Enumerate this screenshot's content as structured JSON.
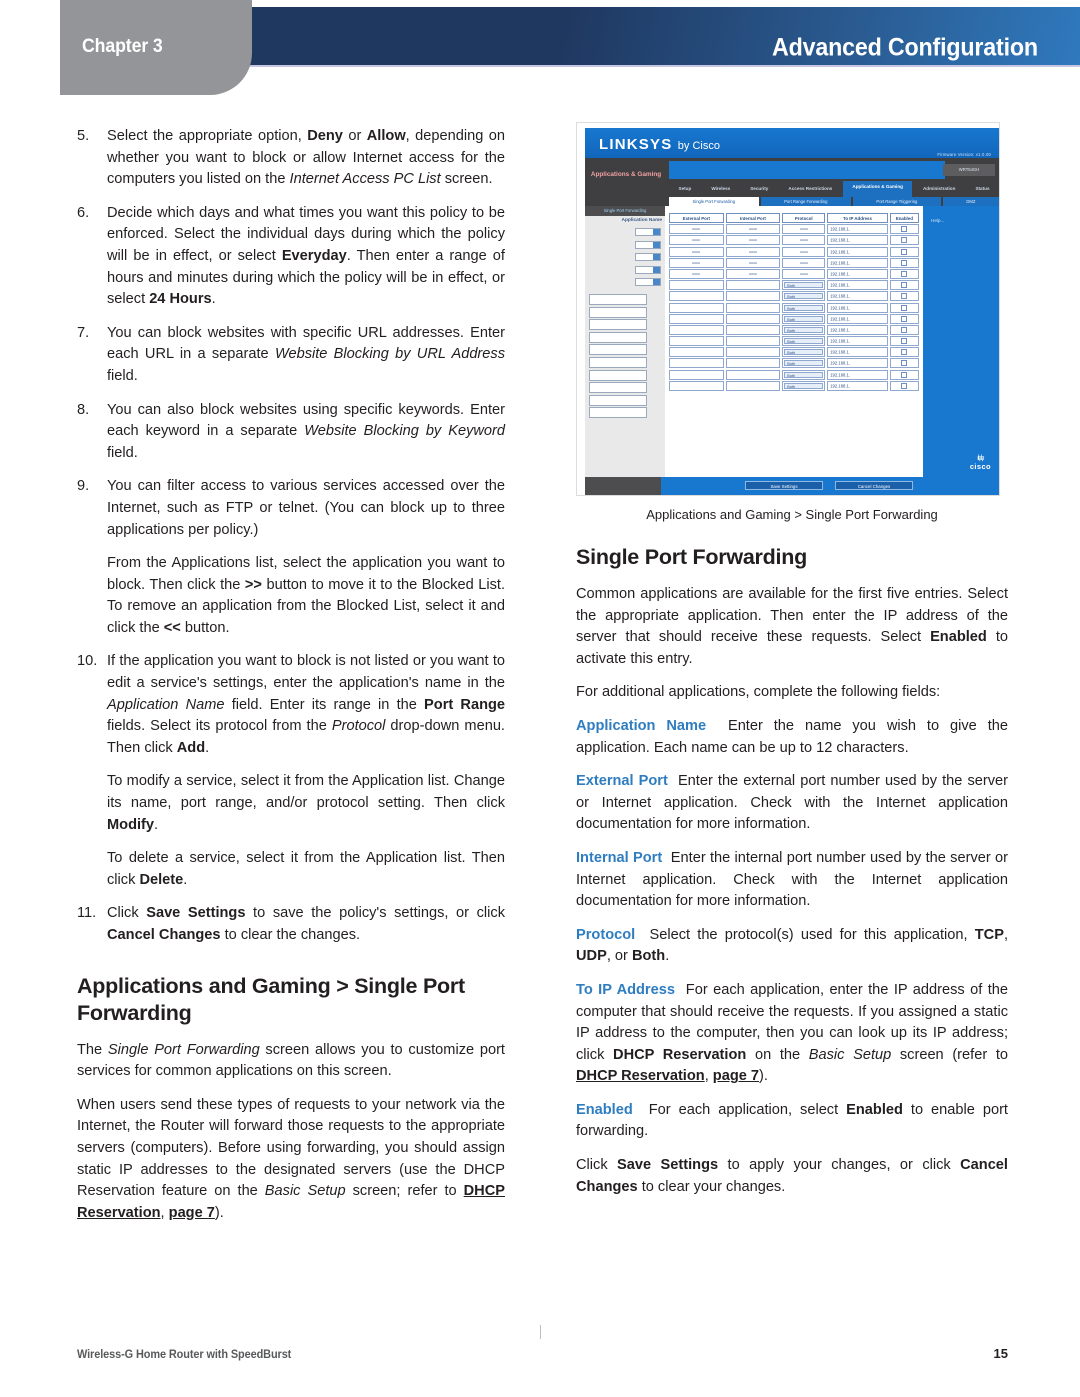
{
  "header": {
    "chapter_label": "Chapter 3",
    "title": "Advanced Configuration",
    "accent_dark": "#1f3860",
    "accent_light": "#2f79bd",
    "tab_gray": "#939598"
  },
  "left_column": {
    "steps": [
      {
        "number": "5.",
        "html": "Select the appropriate option, <b>Deny</b> or <b>Allow</b>, depending on whether you want to block or allow Internet access for the computers you listed on the <i>Internet Access PC List</i> screen."
      },
      {
        "number": "6.",
        "html": "Decide which days and what times you want this policy to be enforced. Select the individual days during which the policy will be in effect, or select <b>Everyday</b>. Then enter a range of hours and minutes during which the policy will be in effect, or select <b>24&nbsp;Hours</b>."
      },
      {
        "number": "7.",
        "html": "You can block websites with specific URL addresses. Enter each URL in a separate <i>Website Blocking by URL Address</i> field."
      },
      {
        "number": "8.",
        "html": "You can also block websites using specific keywords. Enter each keyword in a separate <i>Website Blocking by Keyword</i> field."
      },
      {
        "number": "9.",
        "html": "You can filter access to various services accessed over the Internet, such as FTP or telnet. (You can block up to three applications per policy.)",
        "extra": [
          "From the Applications list, select the application you want to block. Then click the <b>&gt;&gt;</b> button to move it to the Blocked List. To remove an application from the Blocked List, select it and click the <b>&lt;&lt;</b> button."
        ]
      },
      {
        "number": "10.",
        "html": "If the application you want to block is not listed or you want to edit a service's settings, enter the application's name in the <i>Application Name</i> field. Enter its range in the <b>Port Range</b> fields. Select its protocol from the <i>Protocol</i> drop-down menu. Then click <b>Add</b>.",
        "extra": [
          "To modify a service, select it from the Application list. Change its name, port range, and/or protocol setting. Then click <b>Modify</b>.",
          "To delete a service, select it from the Application list. Then click <b>Delete</b>."
        ]
      },
      {
        "number": "11.",
        "html": "Click <b>Save Settings</b> to save the policy's settings, or click <b>Cancel Changes</b> to clear the changes."
      }
    ],
    "section_heading": "Applications and Gaming > Single Port Forwarding",
    "paragraphs": [
      "The <i>Single Port Forwarding</i> screen allows you to customize port services for common applications on this screen.",
      "When users send these types of requests to your network via the Internet, the Router will forward those requests to the appropriate servers (computers). Before using forwarding, you should assign static IP addresses to the designated servers (use the DHCP Reservation feature on the <i>Basic Setup</i> screen; refer to <b class=\"ul-bold\">DHCP Reservation</b>, <b class=\"ul-bold\">page 7</b>)."
    ]
  },
  "screenshot": {
    "logo": "LINKSYS",
    "logo_suffix": "by Cisco",
    "firmware": "Firmware Version: v1.0.00",
    "model_button": "WRT54GH",
    "section_title": "Applications & Gaming",
    "tabs": [
      "Setup",
      "Wireless",
      "Security",
      "Access Restrictions",
      "Applications & Gaming",
      "Administration",
      "Status"
    ],
    "active_tab": "Applications & Gaming",
    "subtabs": [
      "Single Port Forwarding",
      "Port Range Forwarding",
      "Port Range Triggering",
      "DMZ"
    ],
    "active_subtab": "Single Port Forwarding",
    "sidebar_header": "Single Port Forwarding",
    "sidebar_label": "Application Name",
    "table_headers": [
      "External Port",
      "Internal Port",
      "Protocol",
      "To IP Address",
      "Enabled"
    ],
    "ip_prefix": "192.168.1.",
    "protocol_value": "Both",
    "help_label": "Help...",
    "buttons": [
      "Save Settings",
      "Cancel Changes"
    ],
    "brand": "cisco",
    "caption": "Applications and Gaming > Single Port Forwarding"
  },
  "right_column": {
    "heading": "Single Port Forwarding",
    "intro": [
      "Common applications are available for the first five entries. Select the appropriate application. Then enter the IP address of the server that should receive these requests. Select <b>Enabled</b> to activate this entry.",
      "For additional applications, complete the following fields:"
    ],
    "definitions": [
      {
        "term": "Application Name",
        "html": "Enter the name you wish to give the application. Each name can be up to 12 characters."
      },
      {
        "term": "External Port",
        "html": "Enter the external port number used by the server or Internet application. Check with the Internet application documentation for more information."
      },
      {
        "term": "Internal Port",
        "html": "Enter the internal port number used by the server or Internet application. Check with the Internet application documentation for more information."
      },
      {
        "term": "Protocol",
        "html": "Select the protocol(s) used for this application, <b>TCP</b>, <b>UDP</b>, or <b>Both</b>."
      },
      {
        "term": "To IP Address",
        "html": "For each application, enter the IP address of the computer that should receive the requests. If you assigned a static IP address to the computer, then you can look up its IP address; click <b>DHCP Reservation</b> on the <i>Basic Setup</i> screen (refer to <b class=\"ul-bold\">DHCP Reservation</b>, <b class=\"ul-bold\">page 7</b>)."
      },
      {
        "term": "Enabled",
        "html": "For each application, select <b>Enabled</b> to enable port forwarding."
      }
    ],
    "closing": "Click <b>Save Settings</b> to apply your changes, or click <b>Cancel Changes</b> to clear your changes.",
    "term_color": "#2e7dc0"
  },
  "footer": {
    "document_title": "Wireless-G Home Router with SpeedBurst",
    "page_number": "15"
  }
}
